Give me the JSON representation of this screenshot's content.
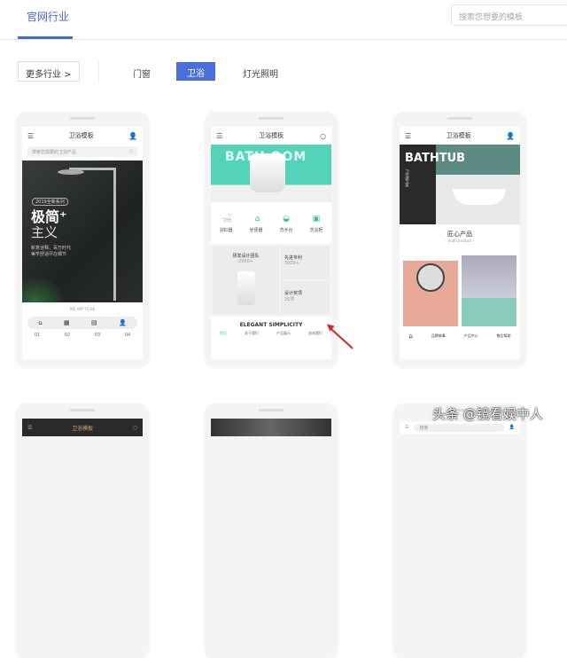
{
  "header": {
    "tab": "官网行业",
    "search_placeholder": "搜索您想要的模板"
  },
  "filters": {
    "more": "更多行业 >",
    "categories": [
      "门窗",
      "卫浴",
      "灯光照明"
    ],
    "active": "卫浴"
  },
  "templates": [
    {
      "title": "卫浴模板",
      "search": "搜索您需要的卫浴产品",
      "hero_tag": "2019全新系列",
      "hero_big": "极简⁺",
      "hero_sub": "主义",
      "hero_desc": "新意诠释，百万时代 美学舒适尽在细节",
      "caption": "WE AIM TO BE",
      "nav": [
        "01",
        "02",
        "03",
        "04"
      ]
    },
    {
      "title": "卫浴模板",
      "banner_text": "BATH  OOM",
      "icons": [
        "浴缸器",
        "坐便器",
        "洗手台",
        "洗浴柜"
      ],
      "tiles": [
        {
          "t": "研发设计团队",
          "s": "2000+"
        },
        {
          "t": "先进专利",
          "s": "3000+"
        },
        {
          "t": "设计奖项",
          "s": "20项"
        }
      ],
      "slogan": "ELEGANT SIMPLICITY",
      "tabbar": [
        "首页",
        "关于我们",
        "产品展示",
        "咨询我们"
      ]
    },
    {
      "title": "卫浴模板",
      "hero": "BATHTUB",
      "hero_side": "卫浴专家",
      "section": "匠心产品",
      "section_sub": "- main product -",
      "nav": [
        "品牌故事",
        "产品中心",
        "售后帮助"
      ]
    }
  ],
  "bottom_row": [
    {
      "title": "卫浴模板"
    },
    {},
    {
      "search": "搜索"
    }
  ],
  "watermark": "头条 @镜看娱中人"
}
